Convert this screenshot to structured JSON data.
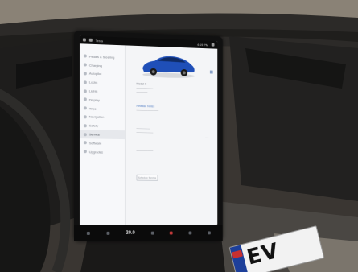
{
  "status_bar": {
    "left_text": "Tesla",
    "time": "4:19 PM"
  },
  "menu": {
    "items": [
      {
        "label": "Pedals & Steering"
      },
      {
        "label": "Charging"
      },
      {
        "label": "Autopilot"
      },
      {
        "label": "Locks"
      },
      {
        "label": "Lights"
      },
      {
        "label": "Display"
      },
      {
        "label": "Trips"
      },
      {
        "label": "Navigation"
      },
      {
        "label": "Safety"
      },
      {
        "label": "Service"
      },
      {
        "label": "Software"
      },
      {
        "label": "Upgrades"
      }
    ],
    "active_index": 9
  },
  "content": {
    "model_name": "Model X",
    "software_link": "Release Notes",
    "button_label": "Schedule Service"
  },
  "dock": {
    "temperature": "20.0"
  },
  "plate": {
    "text": "EV"
  },
  "colors": {
    "car_body": "#1f4fb8",
    "screen_bg": "#f4f5f7",
    "accent_link": "#5b84c6"
  }
}
